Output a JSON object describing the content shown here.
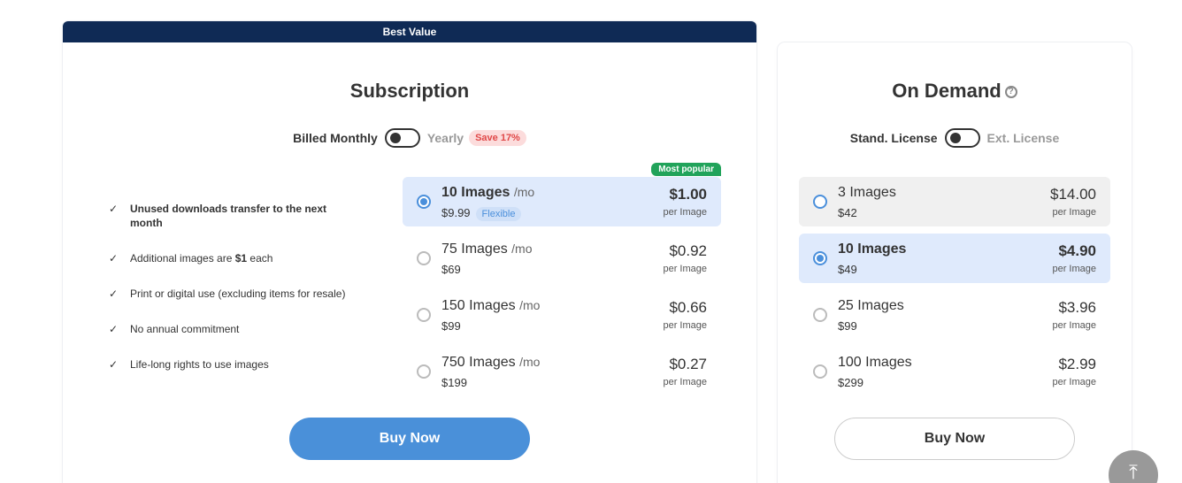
{
  "subscription": {
    "banner": "Best Value",
    "title": "Subscription",
    "toggle": {
      "left_label": "Billed Monthly",
      "right_label": "Yearly",
      "save_badge": "Save 17%"
    },
    "features": [
      {
        "pre": "",
        "bold": "Unused downloads transfer to the next month",
        "post": ""
      },
      {
        "pre": "Additional images are ",
        "bold": "$1",
        "post": " each"
      },
      {
        "pre": "Print or digital use (excluding items for resale)",
        "bold": "",
        "post": ""
      },
      {
        "pre": "No annual commitment",
        "bold": "",
        "post": ""
      },
      {
        "pre": "Life-long rights to use images",
        "bold": "",
        "post": ""
      }
    ],
    "popular_tag": "Most popular",
    "plans": [
      {
        "name": "10 Images",
        "unit": "/mo",
        "price": "$9.99",
        "badge": "Flexible",
        "per_price": "$1.00",
        "per_label": "per Image",
        "selected": true
      },
      {
        "name": "75 Images",
        "unit": "/mo",
        "price": "$69",
        "badge": "",
        "per_price": "$0.92",
        "per_label": "per Image",
        "selected": false
      },
      {
        "name": "150 Images",
        "unit": "/mo",
        "price": "$99",
        "badge": "",
        "per_price": "$0.66",
        "per_label": "per Image",
        "selected": false
      },
      {
        "name": "750 Images",
        "unit": "/mo",
        "price": "$199",
        "badge": "",
        "per_price": "$0.27",
        "per_label": "per Image",
        "selected": false
      }
    ],
    "buy_label": "Buy Now"
  },
  "on_demand": {
    "title": "On Demand",
    "help_icon": "?",
    "toggle": {
      "left_label": "Stand. License",
      "right_label": "Ext. License"
    },
    "plans": [
      {
        "name": "3 Images",
        "price": "$42",
        "per_price": "$14.00",
        "per_label": "per Image",
        "selected": false
      },
      {
        "name": "10 Images",
        "price": "$49",
        "per_price": "$4.90",
        "per_label": "per Image",
        "selected": true
      },
      {
        "name": "25 Images",
        "price": "$99",
        "per_price": "$3.96",
        "per_label": "per Image",
        "selected": false
      },
      {
        "name": "100 Images",
        "price": "$299",
        "per_price": "$2.99",
        "per_label": "per Image",
        "selected": false
      }
    ],
    "buy_label": "Buy Now"
  },
  "scroll_top_icon": "⤒",
  "check_glyph": "✓",
  "colors": {
    "banner": "#0f2a55",
    "accent": "#4a90d9",
    "popular": "#21a35a",
    "save": "#e04848"
  }
}
